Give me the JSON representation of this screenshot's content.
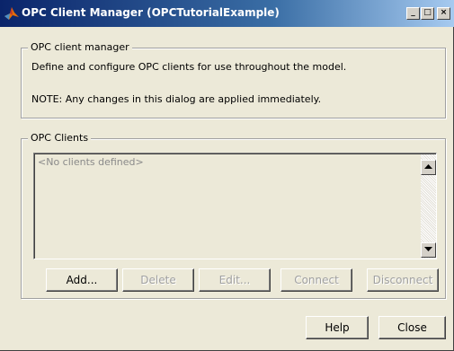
{
  "window": {
    "title": "OPC Client Manager (OPCTutorialExample)",
    "controls": {
      "minimize": "_",
      "maximize": "□",
      "close": "×"
    }
  },
  "manager_group": {
    "legend": "OPC client manager",
    "description": "Define and configure OPC clients for use throughout the model.",
    "note": "NOTE: Any changes in this dialog are applied immediately."
  },
  "clients_group": {
    "legend": "OPC Clients",
    "list_items": [
      "<No clients defined>"
    ],
    "buttons": {
      "add": "Add...",
      "delete": "Delete",
      "edit": "Edit...",
      "connect": "Connect",
      "disconnect": "Disconnect"
    }
  },
  "footer": {
    "help": "Help",
    "close": "Close"
  },
  "icons": {
    "app": "matlab-icon",
    "scroll_up": "arrow-up-icon",
    "scroll_down": "arrow-down-icon"
  },
  "colors": {
    "titlebar_start": "#0a246a",
    "titlebar_end": "#a6caf0",
    "dialog_bg": "#ece9d8",
    "disabled_text": "#a0a0a0"
  }
}
